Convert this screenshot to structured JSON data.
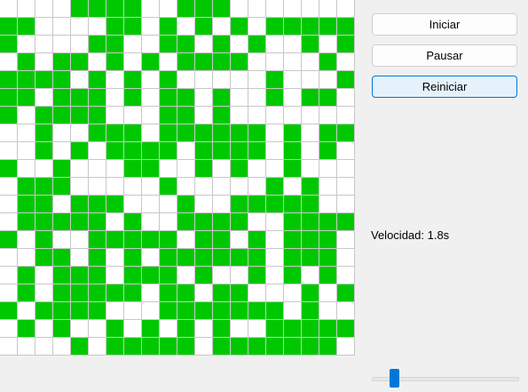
{
  "controls": {
    "start_label": "Iniciar",
    "pause_label": "Pausar",
    "reset_label": "Reiniciar"
  },
  "speed": {
    "label": "Velocidad: 1.8s",
    "slider_fraction": 0.13
  },
  "board": {
    "alive_color": "#00c800",
    "dead_color": "#ffffff",
    "rows": [
      "....1111..111.......",
      "11.0..11.1.1.1.11111",
      "1....11..11.1.1..1.1",
      ".1.11.1.1.1111....1.",
      "1111.1.1.1.....1...1",
      "11.111.1.11.1..1.11.",
      "1.1111...11.1.......",
      "..1..111.111111.1.11",
      "..1.1.1111.1111.1.1.",
      "1..1...11..1.1..1...",
      ".111.....1.....1.1..",
      ".11.111...1..11111..",
      ".11111.1..1111..1111",
      "1.1..11111.11.1.111.",
      "..11.1.1.111111.111.",
      ".1.111.111.1..1.1.1.",
      ".1.11111.11.11...1.1",
      "1.1111...1111111.1..",
      ".1.1..1.1.1.1..11111",
      "....1.11111.1111111."
    ]
  }
}
